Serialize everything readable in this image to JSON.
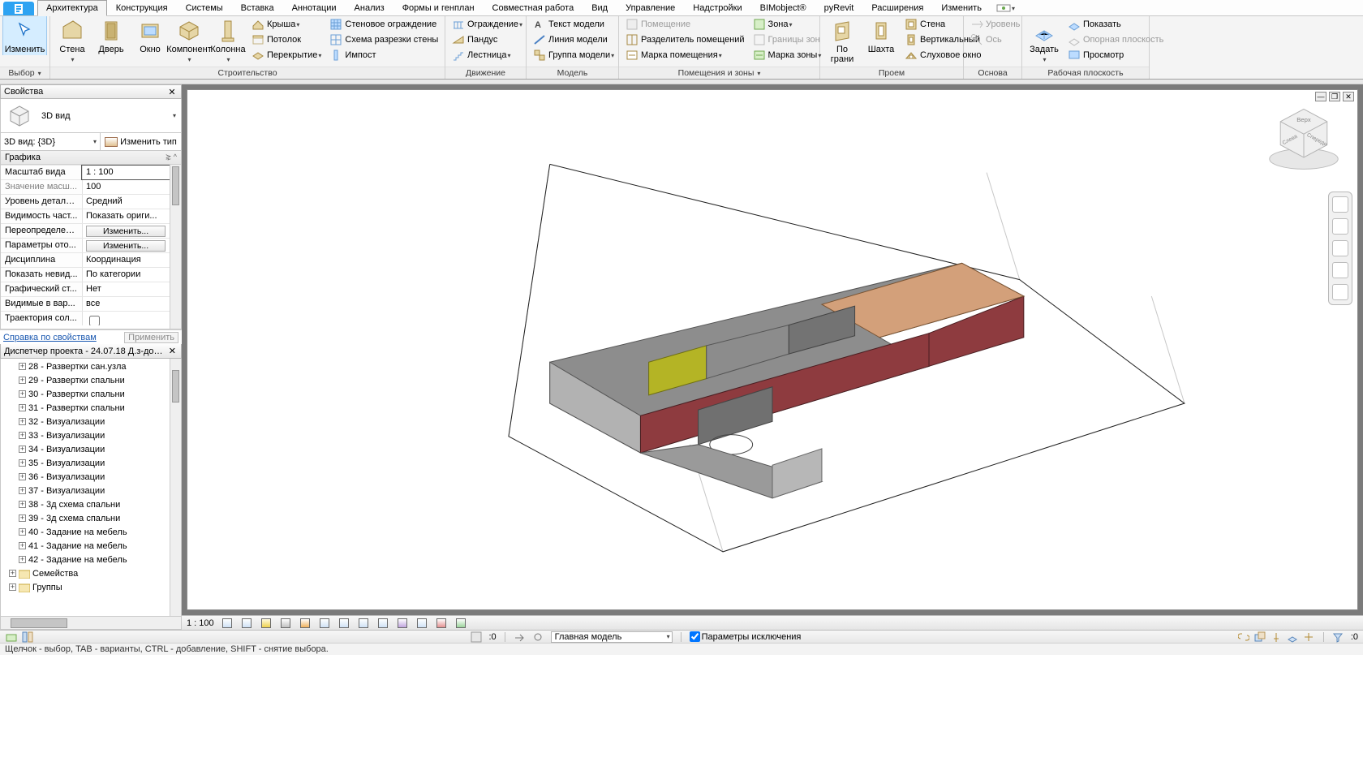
{
  "tabs": {
    "items": [
      "Архитектура",
      "Конструкция",
      "Системы",
      "Вставка",
      "Аннотации",
      "Анализ",
      "Формы и генплан",
      "Совместная работа",
      "Вид",
      "Управление",
      "Надстройки",
      "BIMobject®",
      "pyRevit",
      "Расширения",
      "Изменить"
    ],
    "active_index": 0
  },
  "ribbon": {
    "select": {
      "title": "Выбор",
      "modify": "Изменить"
    },
    "build": {
      "title": "Строительство",
      "big": {
        "wall": "Стена",
        "door": "Дверь",
        "window": "Окно",
        "component": "Компонент",
        "column": "Колонна"
      },
      "col": [
        [
          "Крыша",
          "Потолок",
          "Перекрытие"
        ],
        [
          "Стеновое ограждение",
          "Схема разрезки стены",
          "Импост"
        ]
      ]
    },
    "circ": {
      "title": "Движение",
      "col": [
        [
          "Ограждение",
          "Пандус",
          "Лестница"
        ]
      ]
    },
    "model": {
      "title": "Модель",
      "col": [
        [
          "Текст модели",
          "Линия  модели",
          "Группа модели"
        ]
      ]
    },
    "rooms": {
      "title": "Помещения и зоны",
      "col": [
        [
          "Помещение",
          "Разделитель помещений",
          "Марка помещения"
        ],
        [
          "Зона",
          "Границы  зон",
          "Марка  зоны"
        ]
      ]
    },
    "open": {
      "title": "Проем",
      "big": {
        "face": "По\nграни",
        "shaft": "Шахта"
      },
      "col": [
        [
          "Стена",
          "Вертикальный",
          "Слуховое окно"
        ]
      ]
    },
    "datum": {
      "title": "Основа",
      "col": [
        [
          "Уровень",
          "Ось"
        ]
      ]
    },
    "wp": {
      "title": "Рабочая плоскость",
      "big": {
        "set": "Задать"
      },
      "col": [
        [
          "Показать",
          "Опорная плоскость",
          "Просмотр"
        ]
      ]
    }
  },
  "properties": {
    "title": "Свойства",
    "preview": "3D вид",
    "type_selector": "3D вид: {3D}",
    "edit_type": "Изменить тип",
    "group": "Графика",
    "rows": [
      {
        "k": "Масштаб вида",
        "v": "1 : 100",
        "hl": true
      },
      {
        "k": "Значение масш...",
        "v": "100",
        "dim": true
      },
      {
        "k": "Уровень детали...",
        "v": "Средний"
      },
      {
        "k": "Видимость част...",
        "v": "Показать ориги..."
      },
      {
        "k": "Переопределен...",
        "v": "",
        "btn": "Изменить..."
      },
      {
        "k": "Параметры ото...",
        "v": "",
        "btn": "Изменить..."
      },
      {
        "k": "Дисциплина",
        "v": "Координация"
      },
      {
        "k": "Показать невид...",
        "v": "По категории"
      },
      {
        "k": "Графический ст...",
        "v": "Нет"
      },
      {
        "k": "Видимые в вар...",
        "v": "все"
      },
      {
        "k": "Траектория сол...",
        "v": "",
        "chk": true
      }
    ],
    "help": "Справка по свойствам",
    "apply": "Применить"
  },
  "browser": {
    "title": "Диспетчер проекта - 24.07.18 Д.з-допол...",
    "items": [
      "28 - Развертки сан.узла",
      "29 - Развертки спальни",
      "30 - Развертки спальни",
      "31 - Развертки спальни",
      "32 - Визуализации",
      "33 - Визуализации",
      "34 - Визуализации",
      "35 - Визуализации",
      "36 - Визуализации",
      "37 - Визуализации",
      "38 - 3д схема спальни",
      "39 - 3д схема спальни",
      "40 - Задание на мебель",
      "41 - Задание на мебель",
      "42 - Задание на мебель"
    ],
    "top": [
      "Семейства",
      "Группы"
    ]
  },
  "viewctrl": {
    "scale": "1 : 100"
  },
  "viewcube": {
    "top": "Верх",
    "front": "Спереди",
    "side": "Слева"
  },
  "status": {
    "hint": "Щелчок - выбор, TAB - варианты, CTRL - добавление, SHIFT - снятие выбора.",
    "press_drag": "",
    "zero": ":0",
    "main_model": "Главная модель",
    "exclusion": "Параметры исключения",
    "filter_count": ":0"
  }
}
